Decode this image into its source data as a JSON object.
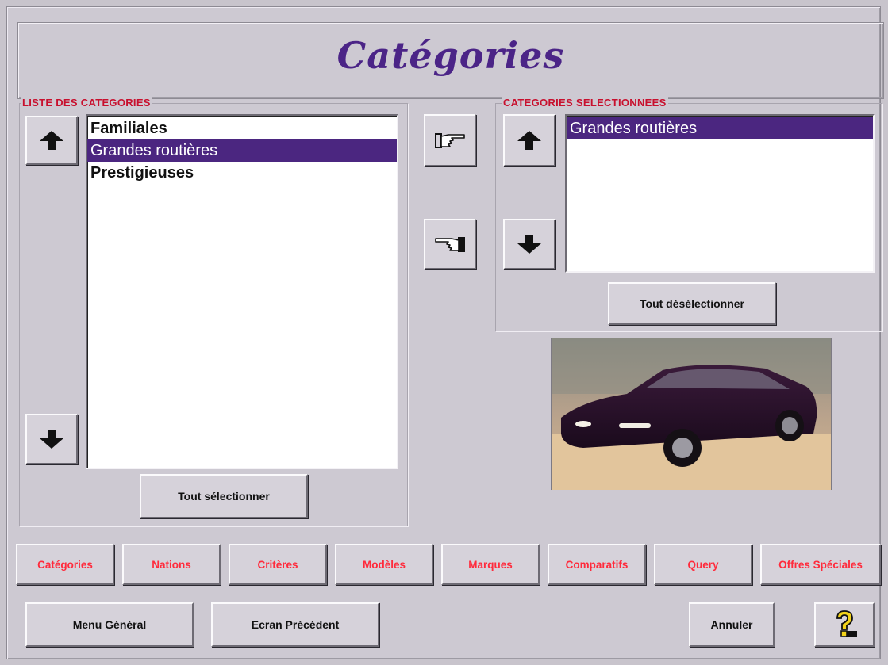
{
  "window": {
    "title": "Catégories"
  },
  "available_list": {
    "label": "LISTE DES CATEGORIES",
    "items": [
      "Familiales",
      "Grandes routières",
      "Prestigieuses"
    ],
    "selected": "Grandes routières",
    "select_all_label": "Tout sélectionner"
  },
  "selected_list": {
    "label": "CATEGORIES SELECTIONNEES",
    "items": [
      "Grandes routières"
    ],
    "deselect_all_label": "Tout désélectionner"
  },
  "icons": {
    "move_up": "arrow-up-icon",
    "move_down": "arrow-down-icon",
    "add_to_selection": "pointing-hand-right-icon",
    "remove_from_selection": "pointing-hand-left-icon",
    "help": "help-question-icon"
  },
  "nav_tabs": [
    "Catégories",
    "Nations",
    "Critères",
    "Modèles",
    "Marques",
    "Comparatifs",
    "Query",
    "Offres Spéciales"
  ],
  "footer": {
    "menu_label": "Menu Général",
    "previous_label": "Ecran Précédent",
    "cancel_label": "Annuler"
  },
  "colors": {
    "title": "#4b2487",
    "selection": "#4b2680",
    "group_label": "#c8102e",
    "nav_label": "#ff2b3c",
    "background": "#cdc9d2"
  }
}
